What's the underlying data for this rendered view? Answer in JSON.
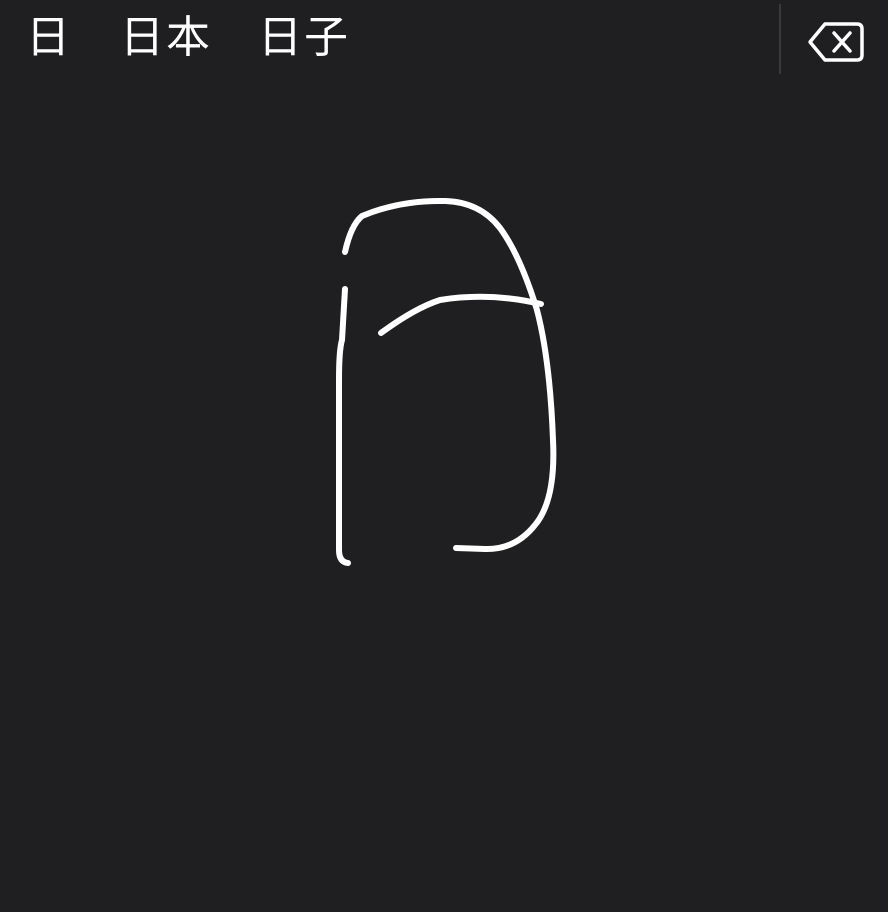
{
  "candidates": [
    {
      "label": "日"
    },
    {
      "label": "日本"
    },
    {
      "label": "日子"
    }
  ],
  "delete_key": {
    "icon": "backspace-icon"
  },
  "drawing": {
    "stroke_color": "#ffffff",
    "background_color": "#1f1e21"
  }
}
